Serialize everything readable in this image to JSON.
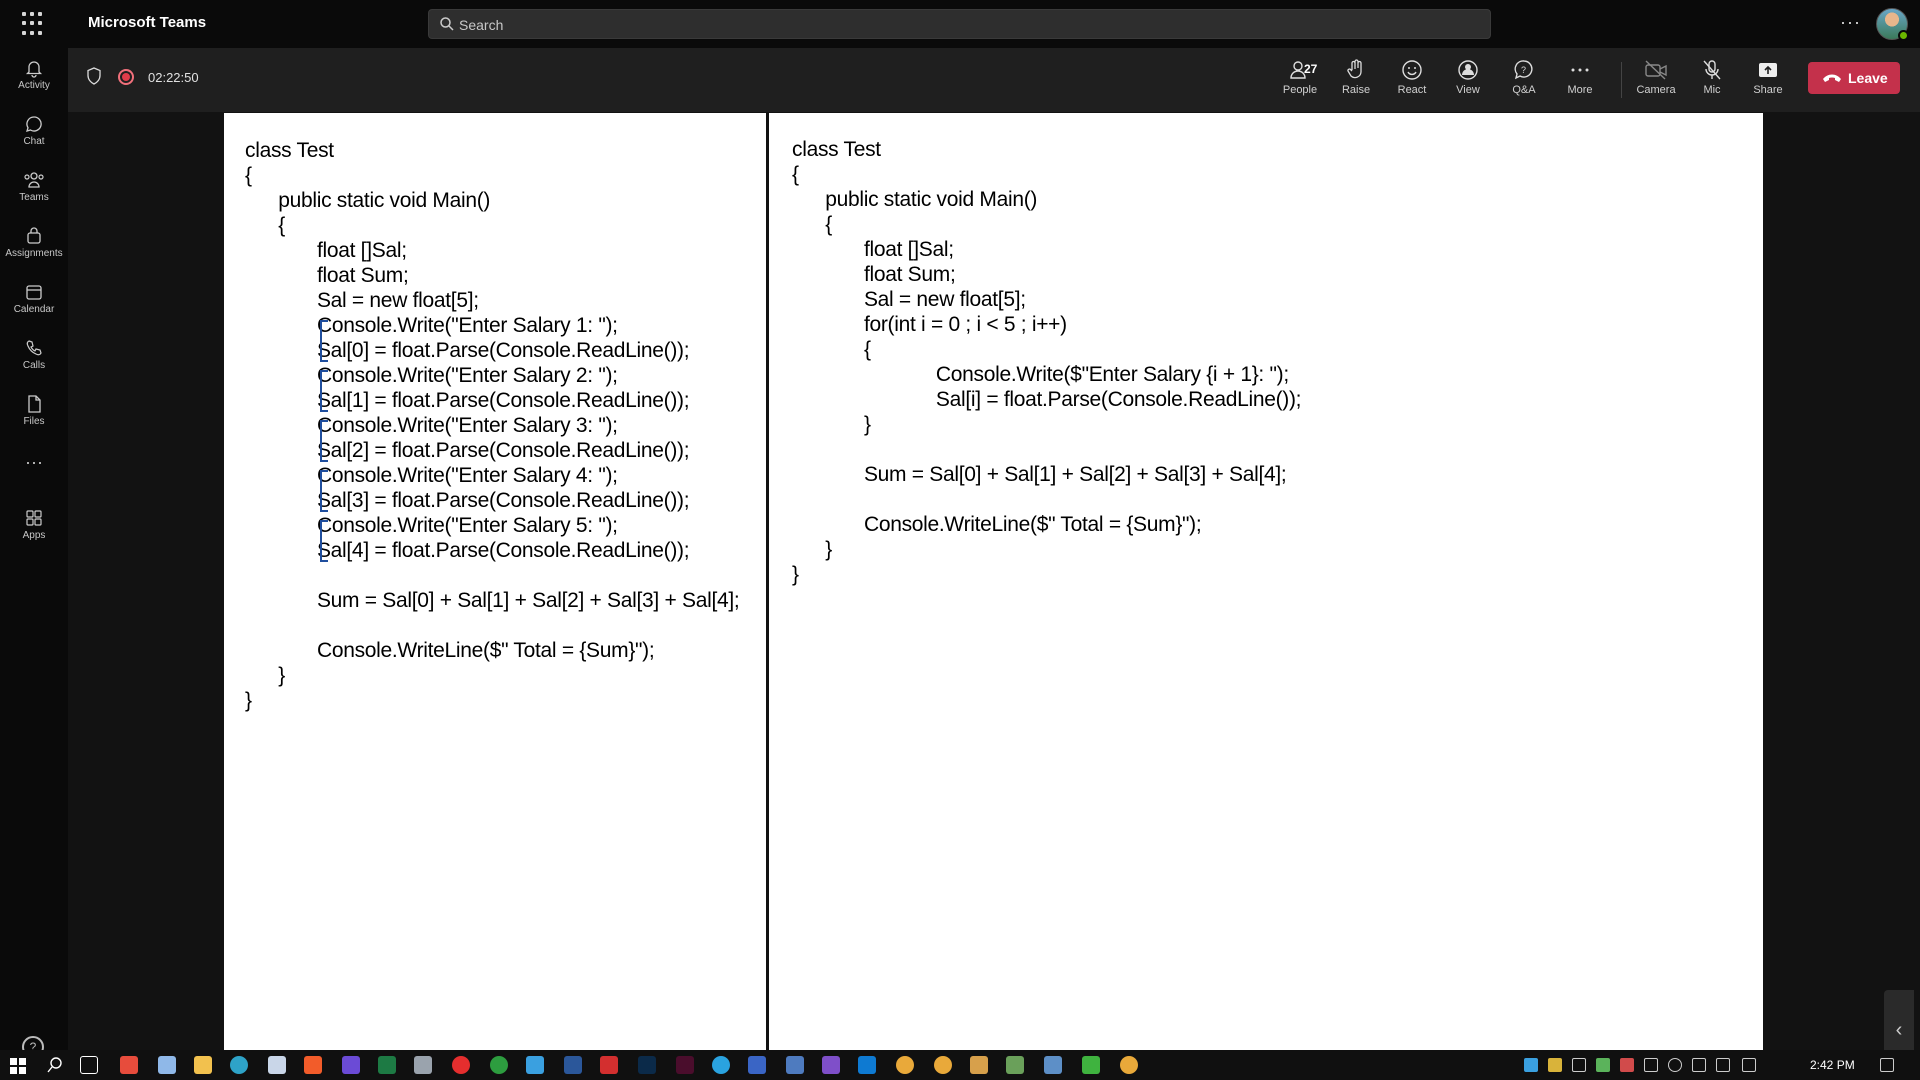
{
  "app": {
    "title": "Microsoft Teams"
  },
  "search": {
    "placeholder": "Search"
  },
  "rail": {
    "items": [
      {
        "label": "Activity",
        "icon": "bell-icon"
      },
      {
        "label": "Chat",
        "icon": "chat-icon"
      },
      {
        "label": "Teams",
        "icon": "teams-icon"
      },
      {
        "label": "Assignments",
        "icon": "assignments-icon"
      },
      {
        "label": "Calendar",
        "icon": "calendar-icon"
      },
      {
        "label": "Calls",
        "icon": "phone-icon"
      },
      {
        "label": "Files",
        "icon": "file-icon"
      },
      {
        "label": "Apps",
        "icon": "apps-icon"
      }
    ],
    "more": "···",
    "help": "?"
  },
  "meeting": {
    "timer": "02:22:50",
    "people_count": "27",
    "tools": {
      "people": "People",
      "raise": "Raise",
      "react": "React",
      "view": "View",
      "qa": "Q&A",
      "more": "More",
      "camera": "Camera",
      "mic": "Mic",
      "share": "Share"
    },
    "leave": "Leave"
  },
  "left_code": [
    "class Test",
    "{",
    "      public static void Main()",
    "      {",
    "             float []Sal;",
    "             float Sum;",
    "             Sal = new float[5];",
    "             Console.Write(\"Enter Salary 1: \");",
    "             Sal[0] = float.Parse(Console.ReadLine());",
    "             Console.Write(\"Enter Salary 2: \");",
    "             Sal[1] = float.Parse(Console.ReadLine());",
    "             Console.Write(\"Enter Salary 3: \");",
    "             Sal[2] = float.Parse(Console.ReadLine());",
    "             Console.Write(\"Enter Salary 4: \");",
    "             Sal[3] = float.Parse(Console.ReadLine());",
    "             Console.Write(\"Enter Salary 5: \");",
    "             Sal[4] = float.Parse(Console.ReadLine());",
    "",
    "             Sum = Sal[0] + Sal[1] + Sal[2] + Sal[3] + Sal[4];",
    "",
    "             Console.WriteLine($\" Total = {Sum}\");",
    "      }",
    "}"
  ],
  "right_code": [
    "class Test",
    "{",
    "      public static void Main()",
    "      {",
    "             float []Sal;",
    "             float Sum;",
    "             Sal = new float[5];",
    "             for(int i = 0 ; i < 5 ; i++)",
    "             {",
    "                          Console.Write($\"Enter Salary {i + 1}: \");",
    "                          Sal[i] = float.Parse(Console.ReadLine());",
    "             }",
    "",
    "             Sum = Sal[0] + Sal[1] + Sal[2] + Sal[3] + Sal[4];",
    "",
    "             Console.WriteLine($\" Total = {Sum}\");",
    "      }",
    "}"
  ],
  "taskbar": {
    "time": "2:42 PM"
  },
  "colors": {
    "leave": "#c4314b",
    "bracket": "#1f4e9e",
    "presence": "#6bb700"
  }
}
